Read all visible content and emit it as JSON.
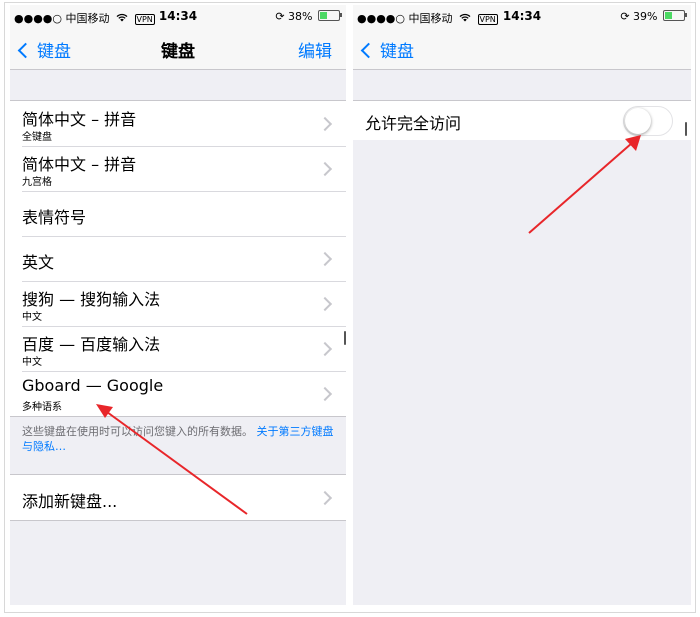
{
  "status_bar": {
    "carrier": "●●●●○ 中国移动",
    "wifi_icon": "wifi-icon",
    "vpn": "VPN",
    "time": "14:34",
    "left_battery": "38%",
    "right_battery": "39%",
    "left_battery_fraction": 0.38,
    "right_battery_fraction": 0.39
  },
  "left": {
    "nav": {
      "back": "键盘",
      "title": "键盘",
      "action": "编辑"
    },
    "keyboards": [
      {
        "title": "简体中文 – 拼音",
        "subtitle": "全键盘"
      },
      {
        "title": "简体中文 – 拼音",
        "subtitle": "九宫格"
      },
      {
        "title": "表情符号",
        "subtitle": ""
      },
      {
        "title": "英文",
        "subtitle": ""
      },
      {
        "title": "搜狗 — 搜狗输入法",
        "subtitle": "中文"
      },
      {
        "title": "百度 — 百度输入法",
        "subtitle": "中文"
      },
      {
        "title": "Gboard — Google",
        "subtitle": "多种语系"
      }
    ],
    "footer": {
      "text": "这些键盘在使用时可以访问您键入的所有数据。",
      "link": "关于第三方键盘与隐私…"
    },
    "add_keyboard": "添加新键盘..."
  },
  "right": {
    "nav": {
      "back": "键盘"
    },
    "setting": {
      "label": "允许完全访问",
      "enabled": false
    }
  },
  "colors": {
    "accent": "#007aff",
    "arrow": "#e8262a",
    "group_background": "#efeff4",
    "battery_green": "#4cd964"
  }
}
